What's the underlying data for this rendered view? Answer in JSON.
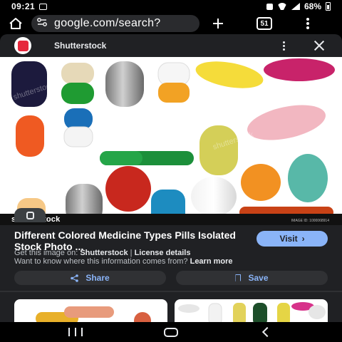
{
  "status_bar": {
    "time": "09:21",
    "battery": "68%"
  },
  "browser": {
    "url": "google.com/search?",
    "tab_count": "51"
  },
  "panel": {
    "source_name": "Shutterstock",
    "image_brand": "shutterstock",
    "image_credit": "IMAGE ID: 1000068914",
    "title": "Different Colored Medicine Types Pills Isolated Stock Photo ...",
    "visit_label": "Visit",
    "get_image_prefix": "Get this image on:",
    "get_image_source": "Shutterstock",
    "separator": "|",
    "license_link": "License details",
    "info_question": "Want to know where this information comes from?",
    "learn_more": "Learn more",
    "share_label": "Share",
    "save_label": "Save"
  },
  "icons": {
    "home": "home-icon",
    "site_info": "site-info-icon",
    "new_tab": "plus-icon",
    "menu": "more-vertical-icon",
    "close": "close-icon",
    "lens": "lens-icon",
    "share": "share-icon",
    "save": "bookmark-icon"
  },
  "colors": {
    "accent": "#8ab4f8",
    "panel_bg": "#202124",
    "brand_red": "#e6283c"
  }
}
